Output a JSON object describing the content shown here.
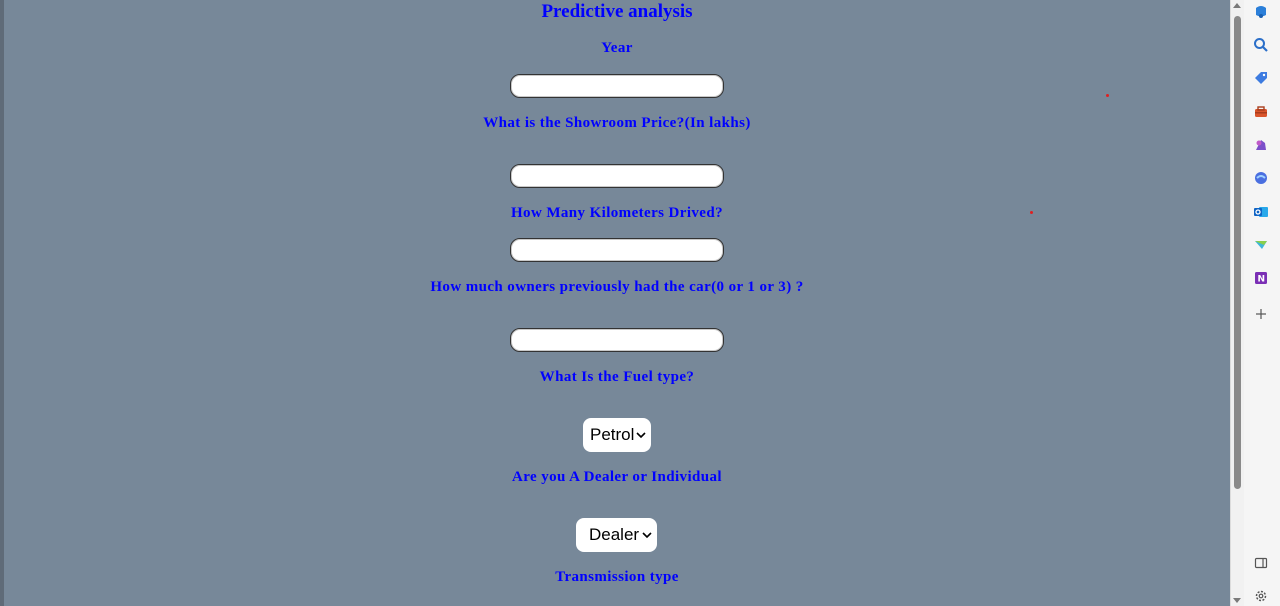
{
  "page": {
    "title": "Predictive analysis",
    "labels": {
      "year": "Year",
      "showroom_price": "What is the Showroom Price?(In lakhs)",
      "kilometers": "How Many Kilometers Drived?",
      "owners": "How much owners previously had the car(0 or 1 or 3) ?",
      "fuel_type": "What Is the Fuel type?",
      "dealer_individual": "Are you A Dealer or Individual",
      "transmission": "Transmission type"
    },
    "inputs": {
      "year": "",
      "showroom_price": "",
      "kilometers": "",
      "owners": ""
    },
    "selects": {
      "fuel_type": "Petrol",
      "seller_type": "Dealer"
    }
  },
  "sidebar": {
    "icons": [
      "copilot-icon",
      "search-icon",
      "shopping-tag-icon",
      "toolbox-icon",
      "games-icon",
      "browser-essentials-icon",
      "outlook-icon",
      "drop-icon",
      "onenote-icon",
      "add-icon",
      "split-screen-icon",
      "settings-icon"
    ]
  },
  "colors": {
    "background": "#778899",
    "label": "#0000ff"
  }
}
